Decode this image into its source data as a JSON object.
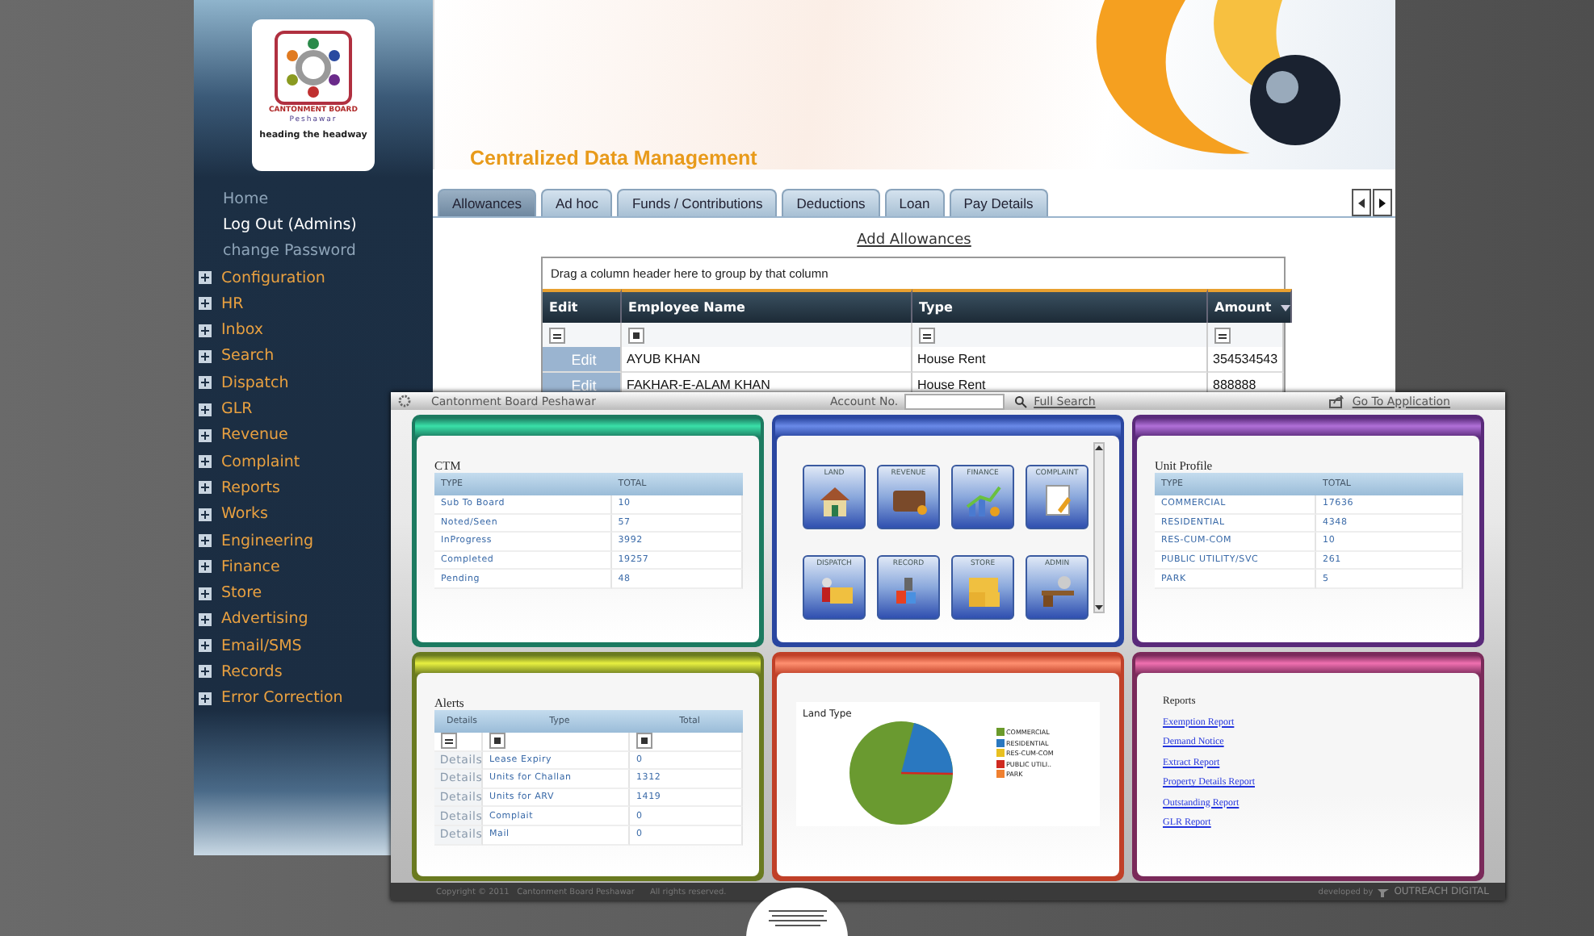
{
  "logo": {
    "name": "CANTONMENT BOARD",
    "city": "Peshawar",
    "tagline": "heading the headway"
  },
  "sidebar": {
    "items": [
      {
        "label": "Home",
        "kind": "link",
        "selected": false
      },
      {
        "label": "Log Out (Admins)",
        "kind": "link",
        "selected": true
      },
      {
        "label": "change Password",
        "kind": "link",
        "selected": false
      },
      {
        "label": "Configuration",
        "kind": "group",
        "expanded": false
      },
      {
        "label": "HR",
        "kind": "group",
        "expanded": false
      },
      {
        "label": "Inbox",
        "kind": "group",
        "expanded": false
      },
      {
        "label": "Search",
        "kind": "group",
        "expanded": false
      },
      {
        "label": "Dispatch",
        "kind": "group",
        "expanded": false
      },
      {
        "label": "GLR",
        "kind": "group",
        "expanded": false
      },
      {
        "label": "Revenue",
        "kind": "group",
        "expanded": false
      },
      {
        "label": "Complaint",
        "kind": "group",
        "expanded": false
      },
      {
        "label": "Reports",
        "kind": "group",
        "expanded": false
      },
      {
        "label": "Works",
        "kind": "group",
        "expanded": false
      },
      {
        "label": "Engineering",
        "kind": "group",
        "expanded": false
      },
      {
        "label": "Finance",
        "kind": "group",
        "expanded": false
      },
      {
        "label": "Store",
        "kind": "group",
        "expanded": false
      },
      {
        "label": "Advertising",
        "kind": "group",
        "expanded": false
      },
      {
        "label": "Email/SMS",
        "kind": "group",
        "expanded": false
      },
      {
        "label": "Records",
        "kind": "group",
        "expanded": false
      },
      {
        "label": "Error Correction",
        "kind": "group",
        "expanded": false
      }
    ]
  },
  "header": {
    "title": "Centralized Data Management"
  },
  "tabs": [
    {
      "label": "Allowances",
      "selected": true
    },
    {
      "label": "Ad hoc",
      "selected": false
    },
    {
      "label": "Funds / Contributions",
      "selected": false
    },
    {
      "label": "Deductions",
      "selected": false
    },
    {
      "label": "Loan",
      "selected": false
    },
    {
      "label": "Pay Details",
      "selected": false
    }
  ],
  "add_link": "Add Allowances",
  "grid": {
    "group_hint": "Drag a column header here to group by that column",
    "columns": [
      {
        "label": "Edit",
        "filter_box": false,
        "sort_desc": false
      },
      {
        "label": "Employee Name",
        "filter_box": true,
        "sort_desc": false
      },
      {
        "label": "Type",
        "filter_box": false,
        "sort_desc": false
      },
      {
        "label": "Amount",
        "filter_box": false,
        "sort_desc": true
      }
    ],
    "rows": [
      {
        "edit": "Edit",
        "name": "AYUB KHAN",
        "type": "House Rent",
        "amount": "354534543"
      },
      {
        "edit": "Edit",
        "name": "FAKHAR-E-ALAM KHAN",
        "type": "House Rent",
        "amount": "888888"
      }
    ]
  },
  "dashboard": {
    "top_bar": {
      "title": "Cantonment Board Peshawar",
      "account_label": "Account No.",
      "search": "Full Search",
      "go_to": "Go To Application"
    },
    "ctm": {
      "title": "CTM",
      "columns": [
        "TYPE",
        "TOTAL"
      ],
      "rows": [
        [
          "Sub To Board",
          "10"
        ],
        [
          "Noted/Seen",
          "57"
        ],
        [
          "InProgress",
          "3992"
        ],
        [
          "Completed",
          "19257"
        ],
        [
          "Pending",
          "48"
        ]
      ]
    },
    "modules": [
      {
        "label": "LAND",
        "kind": "house"
      },
      {
        "label": "REVENUE",
        "kind": "wallet"
      },
      {
        "label": "FINANCE",
        "kind": "chart"
      },
      {
        "label": "COMPLAINT",
        "kind": "document"
      },
      {
        "label": "DISPATCH",
        "kind": "mail"
      },
      {
        "label": "RECORD",
        "kind": "files"
      },
      {
        "label": "STORE",
        "kind": "boxes"
      },
      {
        "label": "ADMIN",
        "kind": "desk"
      }
    ],
    "unit_profile": {
      "title": "Unit Profile",
      "columns": [
        "TYPE",
        "TOTAL"
      ],
      "rows": [
        [
          "COMMERCIAL",
          "17636"
        ],
        [
          "RESIDENTIAL",
          "4348"
        ],
        [
          "RES-CUM-COM",
          "10"
        ],
        [
          "PUBLIC UTILITY/SVC",
          "261"
        ],
        [
          "PARK",
          "5"
        ]
      ]
    },
    "alerts": {
      "title": "Alerts",
      "columns": [
        "Details",
        "Type",
        "Total"
      ],
      "rows": [
        {
          "details": "Details",
          "type": "Lease Expiry",
          "total": "0"
        },
        {
          "details": "Details",
          "type": "Units for Challan",
          "total": "1312"
        },
        {
          "details": "Details",
          "type": "Units for ARV",
          "total": "1419"
        },
        {
          "details": "Details",
          "type": "Complait",
          "total": "0"
        },
        {
          "details": "Details",
          "type": "Mail",
          "total": "0"
        }
      ]
    },
    "land_type": {
      "title": "Land Type",
      "legend": [
        {
          "label": "COMMERCIAL",
          "color": "#6a9a2a"
        },
        {
          "label": "RESIDENTIAL",
          "color": "#2a78c0"
        },
        {
          "label": "RES-CUM-COM",
          "color": "#e8c020"
        },
        {
          "label": "PUBLIC UTILI..",
          "color": "#d02a20"
        },
        {
          "label": "PARK",
          "color": "#f08030"
        }
      ]
    },
    "reports": {
      "title": "Reports",
      "links": [
        "Exemption Report",
        "Demand Notice",
        "Extract Report",
        "Property Details Report",
        "Outstanding Report",
        "GLR Report"
      ]
    },
    "footer": {
      "copyright": "Copyright © 2011   Cantonment Board Peshawar      All rights reserved.",
      "developed": "developed by",
      "company": "OUTREACH DIGITAL"
    }
  }
}
